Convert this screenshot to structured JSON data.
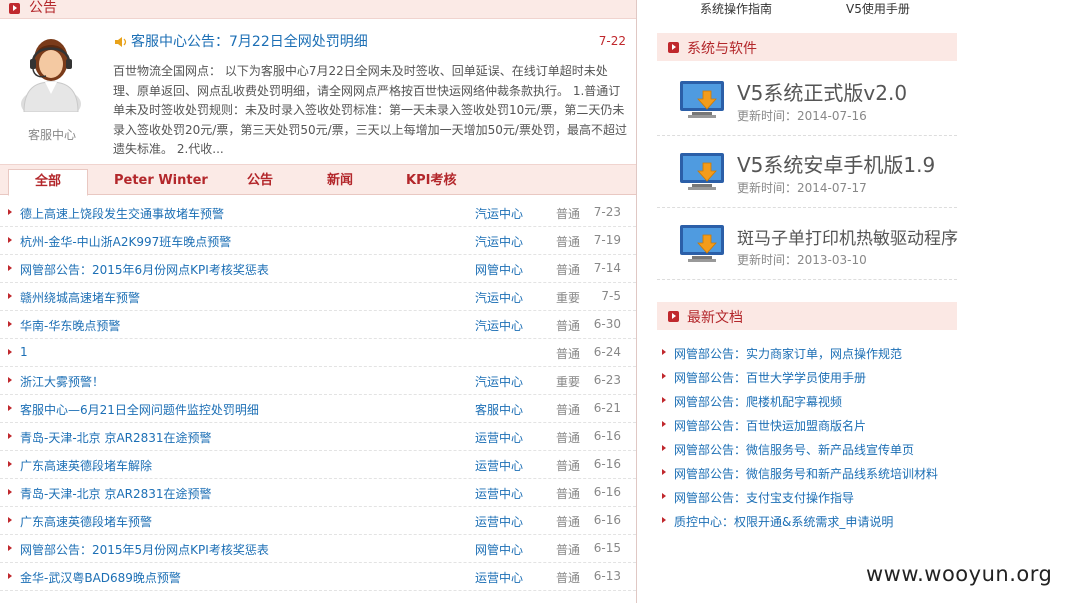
{
  "top_links": [
    "系统操作指南",
    "V5使用手册"
  ],
  "notice": {
    "section_title": "公告",
    "avatar_caption": "客服中心",
    "title": "客服中心公告：7月22日全网处罚明细",
    "date": "7-22",
    "body": "百世物流全国网点： 以下为客服中心7月22日全网未及时签收、回单延误、在线订单超时未处理、原单返回、网点乱收费处罚明细，请全网网点严格按百世快运网络仲裁条款执行。 1.普通订单未及时签收处罚规则：未及时录入签收处罚标准：第一天未录入签收处罚10元/票，第二天仍未录入签收处罚20元/票，第三天处罚50元/票，三天以上每增加一天增加50元/票处罚，最高不超过遗失标准。 2.代收..."
  },
  "tabs": [
    "全部",
    "Peter Winter",
    "公告",
    "新闻",
    "KPI考核"
  ],
  "news": [
    {
      "title": "德上高速上饶段发生交通事故堵车预警",
      "center": "汽运中心",
      "level": "普通",
      "date": "7-23"
    },
    {
      "title": "杭州-金华-中山浙A2K997班车晚点预警",
      "center": "汽运中心",
      "level": "普通",
      "date": "7-19"
    },
    {
      "title": "网管部公告：2015年6月份网点KPI考核奖惩表",
      "center": "网管中心",
      "level": "普通",
      "date": "7-14"
    },
    {
      "title": "赣州绕城高速堵车预警",
      "center": "汽运中心",
      "level": "重要",
      "date": "7-5"
    },
    {
      "title": "华南-华东晚点预警",
      "center": "汽运中心",
      "level": "普通",
      "date": "6-30"
    },
    {
      "title": "1",
      "center": "",
      "level": "普通",
      "date": "6-24"
    },
    {
      "title": "浙江大雾预警！",
      "center": "汽运中心",
      "level": "重要",
      "date": "6-23"
    },
    {
      "title": "客服中心—6月21日全网问题件监控处罚明细",
      "center": "客服中心",
      "level": "普通",
      "date": "6-21"
    },
    {
      "title": "青岛-天津-北京 京AR2831在途预警",
      "center": "运营中心",
      "level": "普通",
      "date": "6-16"
    },
    {
      "title": "广东高速英德段堵车解除",
      "center": "运营中心",
      "level": "普通",
      "date": "6-16"
    },
    {
      "title": "青岛-天津-北京 京AR2831在途预警",
      "center": "运营中心",
      "level": "普通",
      "date": "6-16"
    },
    {
      "title": "广东高速英德段堵车预警",
      "center": "运营中心",
      "level": "普通",
      "date": "6-16"
    },
    {
      "title": "网管部公告：2015年5月份网点KPI考核奖惩表",
      "center": "网管中心",
      "level": "普通",
      "date": "6-15"
    },
    {
      "title": "金华-武汉粤BAD689晚点预警",
      "center": "运营中心",
      "level": "普通",
      "date": "6-13"
    }
  ],
  "software": {
    "section_title": "系统与软件",
    "items": [
      {
        "name": "V5系统正式版v2.0",
        "updated": "更新时间：2014-07-16"
      },
      {
        "name": "V5系统安卓手机版1.9",
        "updated": "更新时间：2014-07-17"
      },
      {
        "name": "斑马子单打印机热敏驱动程序",
        "updated": "更新时间：2013-03-10"
      }
    ]
  },
  "docs": {
    "section_title": "最新文档",
    "items": [
      "网管部公告：实力商家订单，网点操作规范",
      "网管部公告：百世大学学员使用手册",
      "网管部公告：爬楼机配字幕视频",
      "网管部公告：百世快运加盟商版名片",
      "网管部公告：微信服务号、新产品线宣传单页",
      "网管部公告：微信服务号和新产品线系统培训材料",
      "网管部公告：支付宝支付操作指导",
      "质控中心：权限开通&系统需求_申请说明"
    ]
  },
  "watermark": "www.wooyun.org"
}
